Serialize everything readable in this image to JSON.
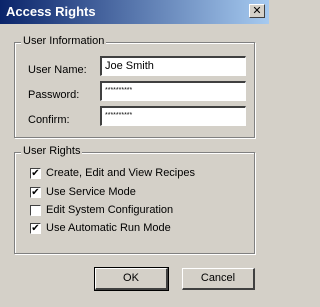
{
  "window": {
    "title": "Access Rights",
    "close_glyph": "✕"
  },
  "user_information": {
    "group_label": "User Information",
    "user_name_label": "User Name:",
    "user_name_value": "Joe Smith",
    "password_label": "Password:",
    "password_value": "**********",
    "confirm_label": "Confirm:",
    "confirm_value": "**********"
  },
  "user_rights": {
    "group_label": "User Rights",
    "items": [
      {
        "label": "Create, Edit and View Recipes",
        "checked": true
      },
      {
        "label": "Use Service Mode",
        "checked": true
      },
      {
        "label": "Edit System Configuration",
        "checked": false
      },
      {
        "label": "Use Automatic Run Mode",
        "checked": true
      }
    ]
  },
  "buttons": {
    "ok_label": "OK",
    "cancel_label": "Cancel"
  },
  "check_glyph": "✔",
  "colors": {
    "title_bar_start": "#0a246a",
    "title_bar_end": "#a6caf0",
    "dialog_face": "#d4d0c8"
  }
}
